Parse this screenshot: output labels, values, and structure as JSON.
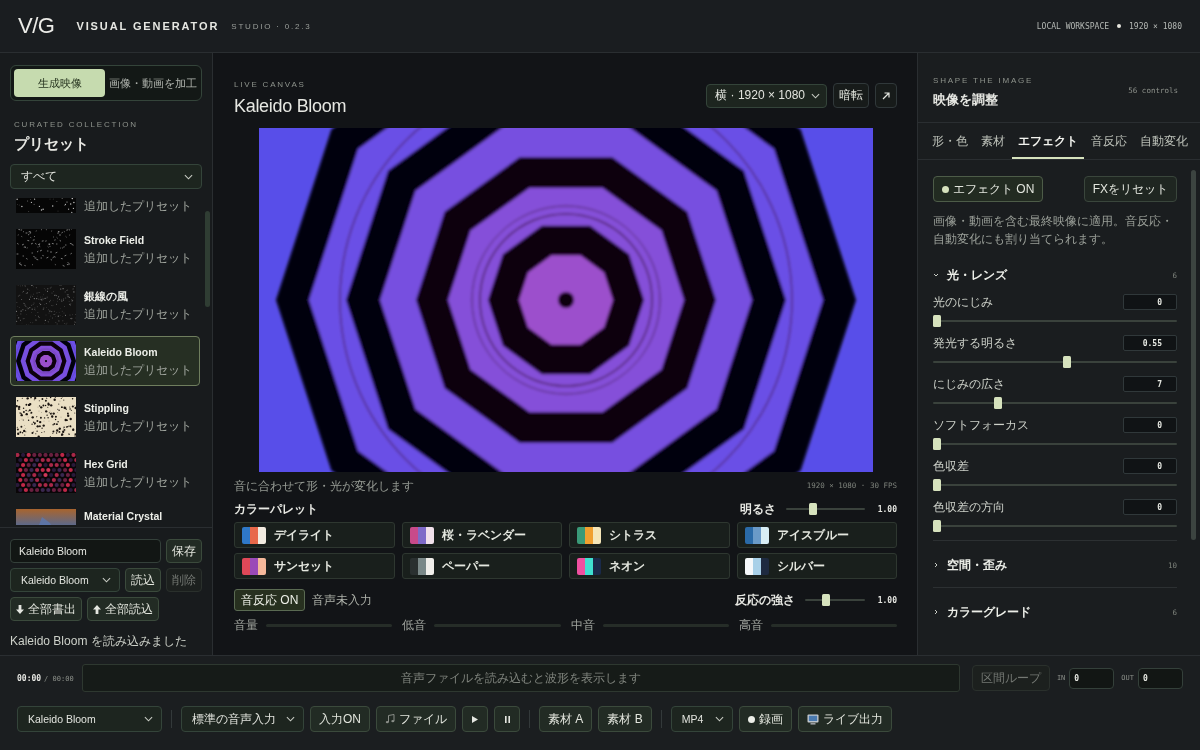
{
  "header": {
    "logo": "V/G",
    "title": "VISUAL GENERATOR",
    "version": "STUDIO · 0.2.3",
    "workspace": "LOCAL WORKSPACE",
    "resolution": "1920 × 1080"
  },
  "mode_tabs": [
    {
      "label": "生成映像",
      "selected": true
    },
    {
      "label": "画像・動画を加工",
      "selected": false
    }
  ],
  "presets": {
    "eyebrow": "CURATED COLLECTION",
    "title": "プリセット",
    "filter": "すべて",
    "items": [
      {
        "kind": "speckle",
        "subtitle": "追加したプリセット",
        "selected": false
      },
      {
        "kind": "strokes",
        "name": "Stroke Field",
        "subtitle": "追加したプリセット",
        "selected": false
      },
      {
        "kind": "dots",
        "name": "銀線の風",
        "subtitle": "追加したプリセット",
        "selected": false
      },
      {
        "kind": "rings",
        "name": "Kaleido Bloom",
        "subtitle": "追加したプリセット",
        "selected": true
      },
      {
        "kind": "stipple",
        "name": "Stippling",
        "subtitle": "追加したプリセット",
        "selected": false
      },
      {
        "kind": "hex",
        "name": "Hex Grid",
        "subtitle": "追加したプリセット",
        "selected": false
      },
      {
        "kind": "crystal",
        "name": "Material Crystal",
        "selected": false
      }
    ],
    "name_field": "Kaleido Bloom",
    "save_button": "保存",
    "load_select": "Kaleido Bloom",
    "load_button": "読込",
    "delete_button": {
      "label": "削除",
      "disabled": true
    },
    "export_button": "全部書出",
    "import_button": "全部読込",
    "status": "Kaleido Bloom を読み込みました"
  },
  "canvas": {
    "eyebrow": "LIVE CANVAS",
    "title": "Kaleido Bloom",
    "orientation_select": "横 · 1920 × 1080",
    "blackout_button": "暗転",
    "caption": "音に合わせて形・光が変化します",
    "spec": "1920 × 1080 · 30 FPS"
  },
  "palette": {
    "label": "カラーパレット",
    "brightness": {
      "label": "明るさ",
      "level": 0.32,
      "reading": "1.00"
    },
    "items": [
      {
        "name": "デイライト",
        "swatches": [
          {
            "color": "#2f78c8"
          },
          {
            "color": "#e8684a"
          },
          {
            "color": "#f2ebe0"
          }
        ]
      },
      {
        "name": "桜・ラベンダー",
        "swatches": [
          {
            "color": "#c84a8a"
          },
          {
            "color": "#7e6ac8"
          },
          {
            "color": "#f0e0ea"
          }
        ]
      },
      {
        "name": "シトラス",
        "swatches": [
          {
            "color": "#3a9a78"
          },
          {
            "color": "#f0a030"
          },
          {
            "color": "#f5e6b8"
          }
        ]
      },
      {
        "name": "アイスブルー",
        "swatches": [
          {
            "color": "#2a6aa8"
          },
          {
            "color": "#6a9ac8"
          },
          {
            "color": "#d8eef5"
          }
        ]
      },
      {
        "name": "サンセット",
        "swatches": [
          {
            "color": "#e04858"
          },
          {
            "color": "#9a4ab8"
          },
          {
            "color": "#f5b89a"
          }
        ]
      },
      {
        "name": "ペーパー",
        "swatches": [
          {
            "color": "#2a3030"
          },
          {
            "color": "#7a8888"
          },
          {
            "color": "#f0eeea"
          }
        ]
      },
      {
        "name": "ネオン",
        "swatches": [
          {
            "color": "#f050a0"
          },
          {
            "color": "#40e0d0"
          },
          {
            "color": "#1a2a4a"
          }
        ]
      },
      {
        "name": "シルバー",
        "swatches": [
          {
            "color": "#f5f8fa"
          },
          {
            "color": "#a8d0e8"
          },
          {
            "color": "#1e2a40"
          }
        ]
      }
    ]
  },
  "audio": {
    "toggle": {
      "label": "音反応 ON",
      "on": true
    },
    "status": "音声未入力",
    "strength": {
      "label": "反応の強さ",
      "level": 0.33,
      "reading": "1.00"
    },
    "meters": [
      {
        "label": "音量",
        "level": 0
      },
      {
        "label": "低音",
        "level": 0
      },
      {
        "label": "中音",
        "level": 0
      },
      {
        "label": "高音",
        "level": 0
      }
    ]
  },
  "inspector": {
    "eyebrow": "SHAPE THE IMAGE",
    "title": "映像を調整",
    "count": "56 controls",
    "tabs": [
      {
        "label": "形・色",
        "selected": false
      },
      {
        "label": "素材",
        "selected": false
      },
      {
        "label": "エフェクト",
        "selected": true
      },
      {
        "label": "音反応",
        "selected": false
      },
      {
        "label": "自動変化",
        "selected": false
      }
    ],
    "effect_toggle": {
      "label": "エフェクト ON",
      "on": true
    },
    "reset_button": "FXをリセット",
    "description": "画像・動画を含む最終映像に適用。音反応・自動変化にも割り当てられます。",
    "sections": [
      {
        "title": "光・レンズ",
        "count": "6",
        "expanded": true,
        "controls": [
          {
            "label": "光のにじみ",
            "value": "0",
            "level": 0
          },
          {
            "label": "発光する明るさ",
            "value": "0.55",
            "level": 0.55
          },
          {
            "label": "にじみの広さ",
            "value": "7",
            "level": 0.26
          },
          {
            "label": "ソフトフォーカス",
            "value": "0",
            "level": 0
          },
          {
            "label": "色収差",
            "value": "0",
            "level": 0
          },
          {
            "label": "色収差の方向",
            "value": "0",
            "level": 0
          }
        ]
      },
      {
        "title": "空間・歪み",
        "count": "10",
        "expanded": false
      },
      {
        "title": "カラーグレード",
        "count": "6",
        "expanded": false
      }
    ]
  },
  "transport": {
    "time": "00:00",
    "duration": "/ 00:00",
    "waveform_placeholder": "音声ファイルを読み込むと波形を表示します",
    "loop_button": {
      "label": "区間ループ",
      "disabled": true
    },
    "in_label": "IN",
    "in_value": "0",
    "out_label": "OUT",
    "out_value": "0"
  },
  "toolbar": {
    "preset_select": "Kaleido Bloom",
    "audio_input_select": "標準の音声入力",
    "input_button": "入力ON",
    "file_button": "ファイル",
    "asset_a_button": "素材 A",
    "asset_b_button": "素材 B",
    "format_select": "MP4",
    "record_button": "録画",
    "live_button": "ライブ出力"
  }
}
